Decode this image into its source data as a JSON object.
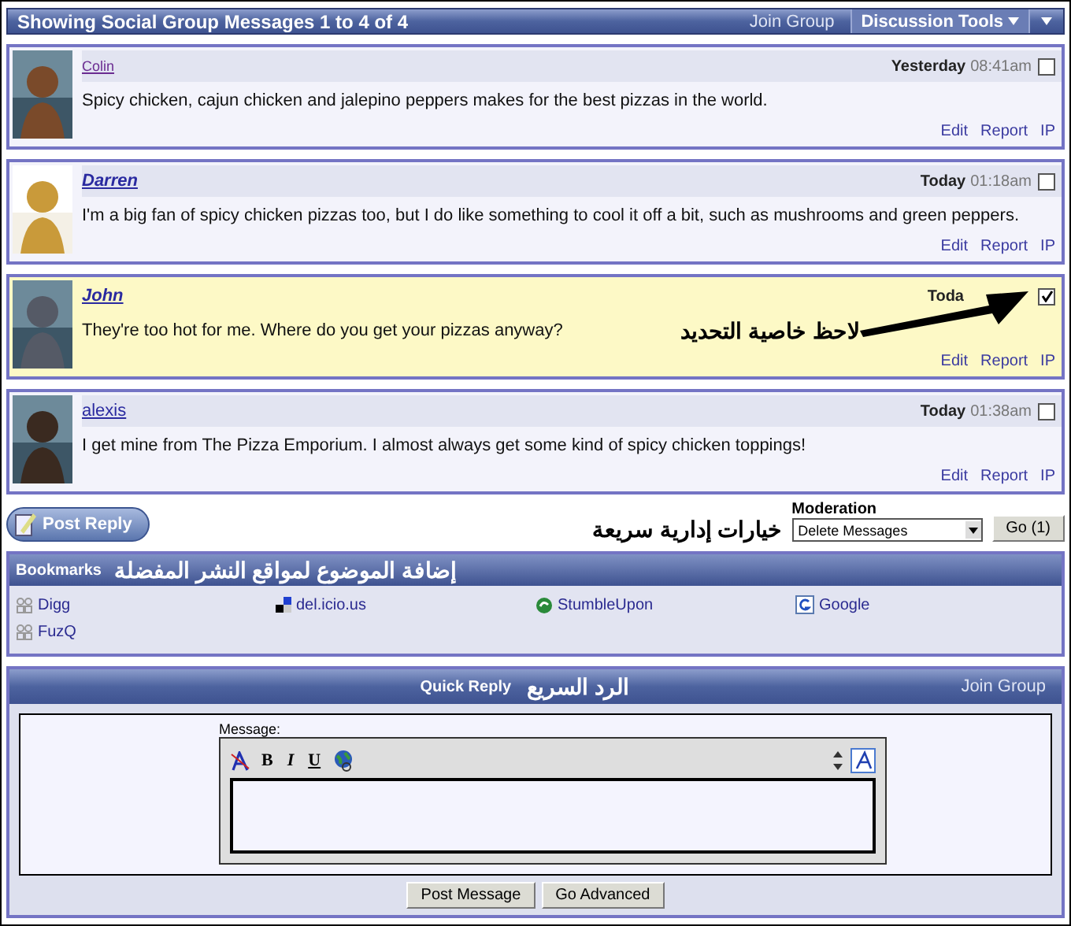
{
  "header": {
    "title": "Showing Social Group Messages 1 to 4 of 4",
    "join": "Join Group",
    "tools": "Discussion Tools"
  },
  "messages": [
    {
      "user": "Colin",
      "kind": "visited",
      "date": "Yesterday",
      "time": "08:41am",
      "checked": false,
      "highlighted": false,
      "text": "Spicy chicken, cajun chicken and jalepino peppers makes for the best pizzas in the world.",
      "actions": [
        "Edit",
        "Report",
        "IP"
      ]
    },
    {
      "user": "Darren",
      "kind": "bold",
      "date": "Today",
      "time": "01:18am",
      "checked": false,
      "highlighted": false,
      "text": "I'm a big fan of spicy chicken pizzas too, but I do like something to cool it off a bit, such as mushrooms and green peppers.",
      "actions": [
        "Edit",
        "Report",
        "IP"
      ]
    },
    {
      "user": "John",
      "kind": "bold",
      "date": "Toda",
      "checked": true,
      "highlighted": true,
      "text": "They're too hot for me. Where do you get your pizzas anyway?",
      "actions": [
        "Edit",
        "Report",
        "IP"
      ],
      "annotation": "لاحظ خاصية التحديد"
    },
    {
      "user": "alexis",
      "kind": "plain",
      "date": "Today",
      "time": "01:38am",
      "checked": false,
      "highlighted": false,
      "text": "I get mine from The Pizza Emporium. I almost always get some kind of spicy chicken toppings!",
      "actions": [
        "Edit",
        "Report",
        "IP"
      ]
    }
  ],
  "post_reply": "Post Reply",
  "moderation": {
    "annotation": "خيارات إدارية سريعة",
    "label": "Moderation",
    "value": "Delete Messages",
    "button": "Go (1)"
  },
  "bookmarks": {
    "title": "Bookmarks",
    "annotation": "إضافة الموضوع لمواقع النشر المفضلة",
    "items": [
      {
        "label": "Digg",
        "kind": "people"
      },
      {
        "label": "del.icio.us",
        "kind": "squares"
      },
      {
        "label": "StumbleUpon",
        "kind": "swirl"
      },
      {
        "label": "Google",
        "kind": "framed"
      },
      {
        "label": "FuzQ",
        "kind": "people"
      }
    ]
  },
  "quick_reply": {
    "title": "Quick Reply",
    "annotation": "الرد السريع",
    "join": "Join Group",
    "message_label": "Message:",
    "format_buttons": [
      "B",
      "I",
      "U"
    ],
    "buttons": [
      "Post Message",
      "Go Advanced"
    ]
  }
}
